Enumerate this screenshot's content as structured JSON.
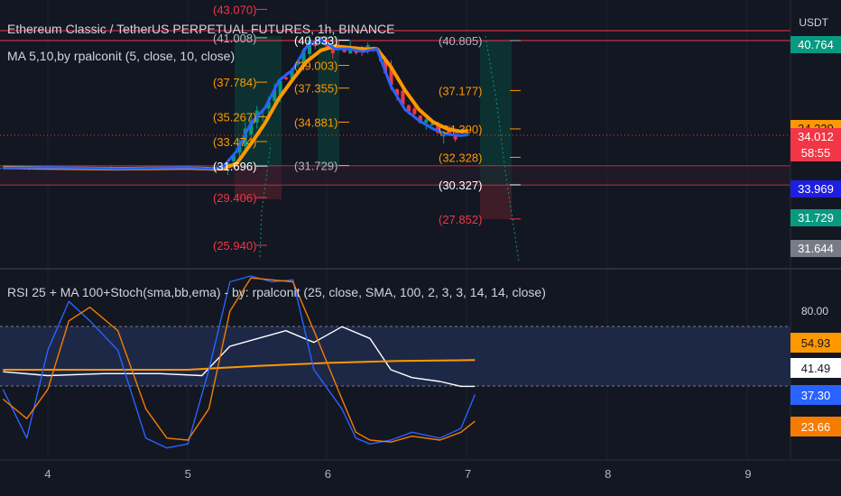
{
  "header": {
    "symbol_title": "Ethereum Classic / TetherUS PERPETUAL FUTURES, 1h, BINANCE",
    "currency": "USDT"
  },
  "main_pane": {
    "ma_legend": "MA 5,10,by rpalconit (5, close, 10, close)",
    "price_badges": [
      {
        "text": "40.764",
        "bg": "#089981",
        "fg": "#ffffff"
      },
      {
        "text": "34.239",
        "bg": "#ff9800",
        "fg": "#131722"
      },
      {
        "text": "34.012",
        "bg": "#f23645",
        "fg": "#ffffff"
      },
      {
        "text": "58:55",
        "bg": "#f23645",
        "fg": "#ffffff"
      },
      {
        "text": "33.969",
        "bg": "#1e1ee0",
        "fg": "#ffffff"
      },
      {
        "text": "31.729",
        "bg": "#089981",
        "fg": "#ffffff"
      },
      {
        "text": "31.644",
        "bg": "#787b86",
        "fg": "#ffffff"
      }
    ],
    "level_labels_left": [
      {
        "text": "(43.070)",
        "color": "#f23645"
      },
      {
        "text": "(41.008)",
        "color": "#b2b5be"
      },
      {
        "text": "(37.784)",
        "color": "#ff9800"
      },
      {
        "text": "(35.267)",
        "color": "#ff9800"
      },
      {
        "text": "(33.474)",
        "color": "#ff9800"
      },
      {
        "text": "(31.696)",
        "color": "#ffffff"
      },
      {
        "text": "(29.406)",
        "color": "#f23645"
      },
      {
        "text": "(25.940)",
        "color": "#f23645"
      }
    ],
    "level_labels_mid": [
      {
        "text": "(40.833)",
        "color": "#ffffff"
      },
      {
        "text": "(39.003)",
        "color": "#ff9800"
      },
      {
        "text": "(37.355)",
        "color": "#ff9800"
      },
      {
        "text": "(34.881)",
        "color": "#ff9800"
      },
      {
        "text": "(31.729)",
        "color": "#b2b5be"
      }
    ],
    "level_labels_right": [
      {
        "text": "(40.805)",
        "color": "#b2b5be"
      },
      {
        "text": "(37.177)",
        "color": "#ff9800"
      },
      {
        "text": "(34.390)",
        "color": "#ff9800"
      },
      {
        "text": "(32.328)",
        "color": "#ff9800"
      },
      {
        "text": "(30.327)",
        "color": "#ffffff"
      },
      {
        "text": "(27.852)",
        "color": "#f23645"
      }
    ]
  },
  "rsi_pane": {
    "legend": "RSI 25 + MA 100+Stoch(sma,bb,ema) - by: rpalconit (25, close, SMA, 100, 2, 3, 3, 14, 14, close)",
    "level_80": "80.00",
    "badges": [
      {
        "text": "54.93",
        "bg": "#ff9800",
        "fg": "#131722"
      },
      {
        "text": "41.49",
        "bg": "#ffffff",
        "fg": "#131722"
      },
      {
        "text": "37.30",
        "bg": "#2962ff",
        "fg": "#ffffff"
      },
      {
        "text": "23.66",
        "bg": "#f57c00",
        "fg": "#ffffff"
      }
    ]
  },
  "time_axis": {
    "labels": [
      "4",
      "5",
      "6",
      "7",
      "8",
      "9"
    ]
  },
  "chart_data": {
    "type": "line",
    "title": "Ethereum Classic / TetherUS PERPETUAL FUTURES, 1h, BINANCE",
    "x_day_ticks": [
      4,
      5,
      6,
      7,
      8,
      9
    ],
    "y_unit": "USDT",
    "price_series": [
      {
        "name": "MA 5",
        "color": "#2962ff",
        "x": [
          3.68,
          4.0,
          4.5,
          5.0,
          5.15,
          5.25,
          5.35,
          5.45,
          5.55,
          5.65,
          5.75,
          5.85,
          5.95,
          6.05,
          6.15,
          6.25,
          6.35,
          6.45,
          6.55,
          6.65,
          6.75,
          6.85,
          6.95,
          7.0
        ],
        "values": [
          31.55,
          31.6,
          31.5,
          31.6,
          31.5,
          31.6,
          32.8,
          34.8,
          35.9,
          37.9,
          38.7,
          40.4,
          40.9,
          40.2,
          40.2,
          40.0,
          40.2,
          37.5,
          35.8,
          35.0,
          34.4,
          34.0,
          33.9,
          33.97
        ]
      },
      {
        "name": "MA 10",
        "color": "#ff9800",
        "x": [
          3.68,
          4.0,
          4.5,
          5.0,
          5.15,
          5.25,
          5.35,
          5.45,
          5.55,
          5.65,
          5.75,
          5.85,
          5.95,
          6.05,
          6.15,
          6.25,
          6.35,
          6.45,
          6.55,
          6.65,
          6.75,
          6.85,
          6.95,
          7.0
        ],
        "values": [
          31.6,
          31.55,
          31.5,
          31.55,
          31.5,
          31.5,
          31.9,
          33.3,
          34.8,
          36.6,
          38.0,
          39.3,
          40.1,
          40.4,
          40.3,
          40.2,
          40.2,
          38.9,
          37.2,
          35.8,
          34.9,
          34.4,
          34.2,
          34.24
        ]
      }
    ],
    "rsi_series": [
      {
        "name": "RSI",
        "color": "#ffffff",
        "x": [
          3.68,
          4.0,
          4.4,
          4.8,
          5.1,
          5.3,
          5.5,
          5.7,
          5.9,
          6.1,
          6.3,
          6.45,
          6.6,
          6.8,
          6.95,
          7.05
        ],
        "values": [
          49,
          47,
          48,
          48,
          47,
          62,
          66,
          70,
          64,
          72,
          66,
          50,
          46,
          44,
          41.5,
          41.49
        ]
      },
      {
        "name": "MA 100",
        "color": "#ff9800",
        "x": [
          3.68,
          4.0,
          4.5,
          5.0,
          5.5,
          6.0,
          6.5,
          7.05
        ],
        "values": [
          50,
          50,
          50,
          50,
          52,
          53.5,
          54.5,
          54.93
        ]
      },
      {
        "name": "Stoch %K",
        "color": "#2962ff",
        "x": [
          3.68,
          3.85,
          4.0,
          4.15,
          4.3,
          4.5,
          4.7,
          4.85,
          5.0,
          5.15,
          5.3,
          5.45,
          5.6,
          5.75,
          5.9,
          6.1,
          6.2,
          6.3,
          6.45,
          6.6,
          6.8,
          6.95,
          7.05
        ],
        "values": [
          40,
          15,
          60,
          85,
          75,
          60,
          15,
          10,
          12,
          50,
          95,
          98,
          95,
          96,
          50,
          30,
          15,
          12,
          14,
          18,
          15,
          20,
          37.3
        ]
      },
      {
        "name": "Stoch %D",
        "color": "#f57c00",
        "x": [
          3.68,
          3.85,
          4.0,
          4.15,
          4.3,
          4.5,
          4.7,
          4.85,
          5.0,
          5.15,
          5.3,
          5.45,
          5.6,
          5.75,
          5.9,
          6.1,
          6.2,
          6.3,
          6.45,
          6.6,
          6.8,
          6.95,
          7.05
        ],
        "values": [
          35,
          25,
          40,
          75,
          82,
          70,
          30,
          15,
          14,
          30,
          80,
          97,
          96,
          95,
          70,
          35,
          18,
          14,
          13,
          16,
          14,
          18,
          23.66
        ]
      }
    ]
  }
}
